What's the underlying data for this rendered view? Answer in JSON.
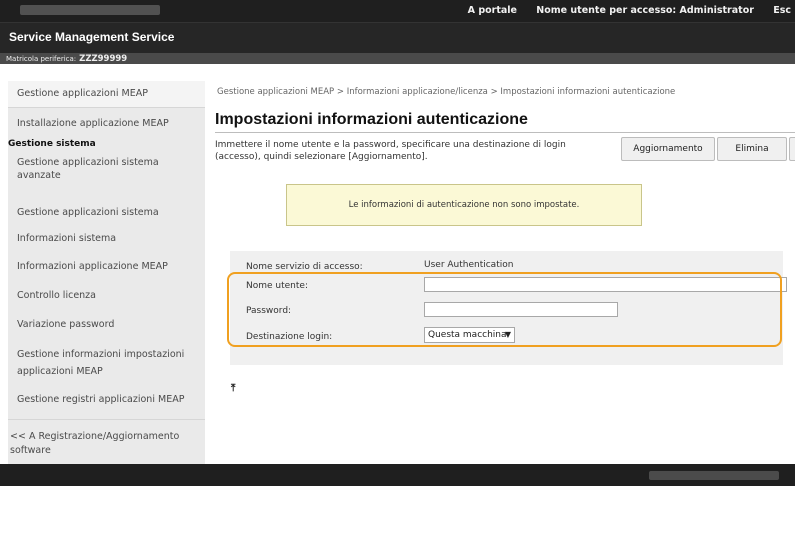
{
  "topbar": {
    "portal_link": "A portale",
    "user_label": "Nome utente per accesso:",
    "user_name": "Administrator",
    "logout": "Esc"
  },
  "app": {
    "title": "Service Management Service"
  },
  "serial": {
    "label": "Matricola periferica:",
    "value": "ZZZ99999"
  },
  "sidebar": {
    "item_gestione_app_meap": "Gestione applicazioni MEAP",
    "item_installazione": "Installazione applicazione MEAP",
    "section_sistema": "Gestione sistema",
    "item_gestione_app_sistema_avanzate_1": "Gestione applicazioni sistema",
    "item_gestione_app_sistema_avanzate_2": "avanzate",
    "item_gestione_app_sistema": "Gestione applicazioni sistema",
    "item_info_sistema": "Informazioni sistema",
    "item_info_app_meap": "Informazioni applicazione MEAP",
    "item_controllo_licenza": "Controllo licenza",
    "item_variazione_password": "Variazione password",
    "item_gestione_info_impostazioni_1": "Gestione informazioni impostazioni",
    "item_gestione_info_impostazioni_2": "applicazioni MEAP",
    "item_gestione_registri": "Gestione registri applicazioni MEAP",
    "item_back_1": "<< A Registrazione/Aggiornamento",
    "item_back_2": "software"
  },
  "breadcrumb": "Gestione applicazioni MEAP > Informazioni applicazione/licenza > Impostazioni informazioni autenticazione",
  "page": {
    "title": "Impostazioni informazioni autenticazione",
    "description": "Immettere il nome utente e la password, specificare una destinazione di login (accesso), quindi selezionare [Aggiornamento]."
  },
  "buttons": {
    "update": "Aggiornamento",
    "delete": "Elimina"
  },
  "alert": "Le informazioni di autenticazione non sono impostate.",
  "form": {
    "service_label": "Nome servizio di accesso:",
    "service_value": "User Authentication",
    "username_label": "Nome utente:",
    "username_value": "",
    "password_label": "Password:",
    "password_value": "",
    "destination_label": "Destinazione login:",
    "destination_value": "Questa macchina"
  },
  "totop_icon": "to-top-icon",
  "colors": {
    "highlight": "#f0a020",
    "alert_bg": "#fbf9d6",
    "header_bg": "#1f1f1f"
  }
}
